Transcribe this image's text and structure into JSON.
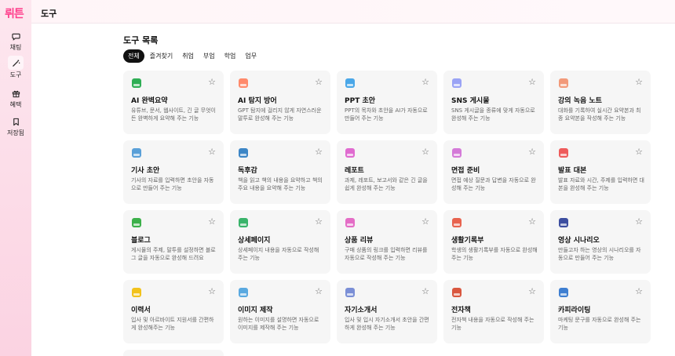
{
  "app": {
    "logo": "뤼튼",
    "header_title": "도구"
  },
  "sidebar": {
    "items": [
      {
        "label": "채팅",
        "icon": "chat-bubble-icon"
      },
      {
        "label": "도구",
        "icon": "magic-wand-icon",
        "active": true
      },
      {
        "label": "혜택",
        "icon": "gift-icon"
      },
      {
        "label": "저장됨",
        "icon": "bookmark-icon"
      }
    ]
  },
  "main": {
    "title": "도구 목록",
    "tabs": [
      "전체",
      "즐겨찾기",
      "취업",
      "부업",
      "학업",
      "업무"
    ],
    "active_tab": "전체",
    "cards": [
      {
        "title": "AI 완벽요약",
        "desc": "유튜브, 문서, 웹사이트, 긴 글 무엇이든 완벽하게 요약해 주는 기능",
        "icon": "summary-icon",
        "color": "#2fae55"
      },
      {
        "title": "AI 탐지 방어",
        "desc": "GPT 탐지에 걸리지 않게 자연스러운 말투로 완성해 주는 기능",
        "icon": "shield-icon",
        "color": "#ff8a6b"
      },
      {
        "title": "PPT 초안",
        "desc": "PPT의 목차와 초안을 AI가 자동으로 만들어 주는 기능",
        "icon": "presentation-icon",
        "color": "#4aa7e8"
      },
      {
        "title": "SNS 게시물",
        "desc": "SNS 게시글을 종류에 맞게 자동으로 완성해 주는 기능",
        "icon": "phone-icon",
        "color": "#9aa3f5"
      },
      {
        "title": "강의 녹음 노트",
        "desc": "대화를 기록하여 실시간 요약본과 최종 요약본을 작성해 주는 기능",
        "icon": "recorder-icon",
        "color": "#f29a7a"
      },
      {
        "title": "기사 초안",
        "desc": "기사의 자료를 입력하면 초안을 자동으로 만들어 주는 기능",
        "icon": "newspaper-icon",
        "color": "#5aa0d8"
      },
      {
        "title": "독후감",
        "desc": "책을 읽고 책의 내용을 요약하고 책의 주요 내용을 요약해 주는 기능",
        "icon": "book-icon",
        "color": "#3d86c6"
      },
      {
        "title": "레포트",
        "desc": "과제, 레포트, 보고서와 같은 긴 글을 쉽게 완성해 주는 기능",
        "icon": "report-icon",
        "color": "#e06bd0"
      },
      {
        "title": "면접 준비",
        "desc": "면접 예상 질문과 답변을 자동으로 완성해 주는 기능",
        "icon": "briefcase-icon",
        "color": "#d47ad8"
      },
      {
        "title": "발표 대본",
        "desc": "발표 자료와 시간, 주제를 입력하면 대본을 완성해 주는 기능",
        "icon": "script-icon",
        "color": "#ee5b5b"
      },
      {
        "title": "블로그",
        "desc": "게시물의 주제, 말투를 설정하면 블로그 글을 자동으로 완성해 드려요",
        "icon": "blog-icon",
        "color": "#3cb04a"
      },
      {
        "title": "상세페이지",
        "desc": "상세페이지 내용을 자동으로 작성해 주는 기능",
        "icon": "webpage-icon",
        "color": "#39b36a"
      },
      {
        "title": "상품 리뷰",
        "desc": "구매 상품의 링크를 입력하면 리뷰를 자동으로 작성해 주는 기능",
        "icon": "review-icon",
        "color": "#e46dc6"
      },
      {
        "title": "생활기록부",
        "desc": "학생의 생활기록부를 자동으로 완성해 주는 기능",
        "icon": "school-icon",
        "color": "#e8634f"
      },
      {
        "title": "영상 시나리오",
        "desc": "만들고자 하는 영상의 시나리오를 자동으로 만들어 주는 기능",
        "icon": "video-icon",
        "color": "#3d4fa0"
      },
      {
        "title": "이력서",
        "desc": "입사 및 아르바이트 지원서를 간편하게 완성해주는 기능",
        "icon": "resume-icon",
        "color": "#f2c21b"
      },
      {
        "title": "이미지 제작",
        "desc": "원하는 이미지를 설명하면 자동으로 이미지를 제작해 주는 기능",
        "icon": "image-icon",
        "color": "#5aa9e0"
      },
      {
        "title": "자기소개서",
        "desc": "입사 및 입시 자기소개서 초안을 간편하게 완성해 주는 기능",
        "icon": "profile-doc-icon",
        "color": "#7b8fd6"
      },
      {
        "title": "전자책",
        "desc": "전자책 내용을 자동으로 작성해 주는 기능",
        "icon": "ebook-icon",
        "color": "#d9573f"
      },
      {
        "title": "카피라이팅",
        "desc": "마케팅 문구를 자동으로 완성해 주는 기능",
        "icon": "pen-icon",
        "color": "#3f7fd1"
      }
    ]
  }
}
